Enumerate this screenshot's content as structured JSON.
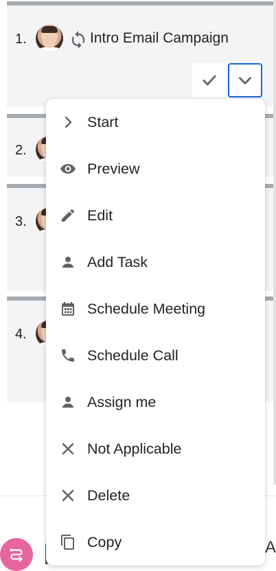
{
  "tasks": [
    {
      "number": "1.",
      "title": "Intro Email Campaign"
    },
    {
      "number": "2."
    },
    {
      "number": "3."
    },
    {
      "number": "4."
    }
  ],
  "actions": {
    "complete_icon": "check-icon",
    "dropdown_icon": "chevron-down-icon"
  },
  "menu": {
    "items": [
      {
        "label": "Start",
        "icon": "chevron-right-icon"
      },
      {
        "label": "Preview",
        "icon": "eye-icon"
      },
      {
        "label": "Edit",
        "icon": "pencil-icon"
      },
      {
        "label": "Add Task",
        "icon": "person-icon"
      },
      {
        "label": "Schedule Meeting",
        "icon": "calendar-icon"
      },
      {
        "label": "Schedule Call",
        "icon": "phone-icon"
      },
      {
        "label": "Assign me",
        "icon": "person-icon"
      },
      {
        "label": "Not Applicable",
        "icon": "close-icon"
      },
      {
        "label": "Delete",
        "icon": "close-icon"
      },
      {
        "label": "Copy",
        "icon": "copy-icon"
      }
    ]
  },
  "bottom": {
    "edge_text": "A"
  },
  "colors": {
    "accent": "#1a66d2",
    "fab": "#e7669e",
    "icon": "#5f6368"
  }
}
